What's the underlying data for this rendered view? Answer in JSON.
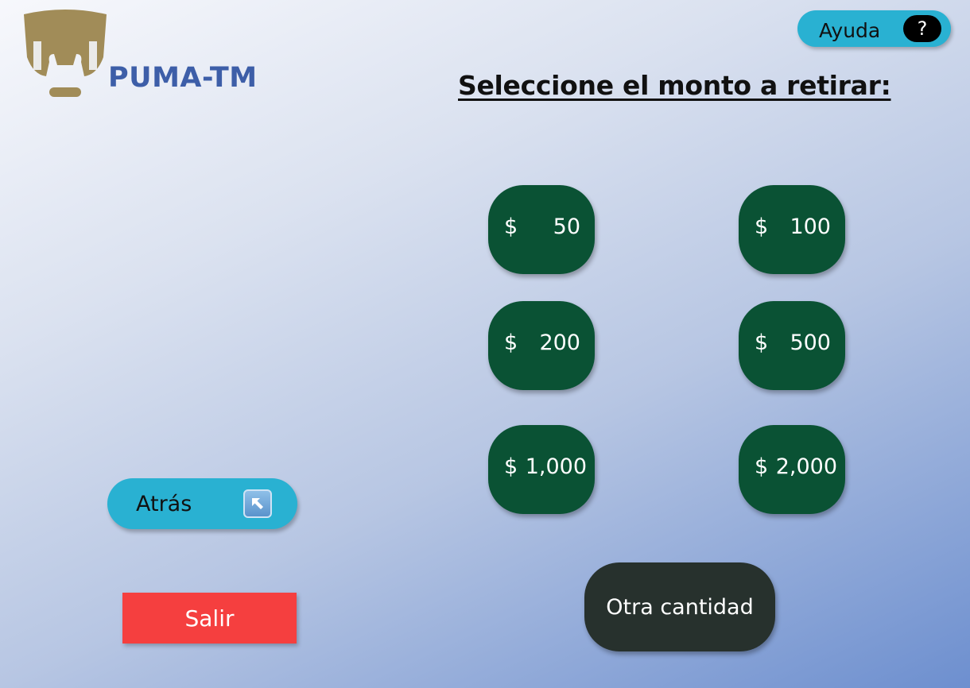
{
  "brand": {
    "name": "PUMA-TM",
    "logo_color": "#a18c58",
    "name_color": "#3d5ea8"
  },
  "help": {
    "label": "Ayuda",
    "icon": "question-icon",
    "icon_glyph": "?"
  },
  "title": "Seleccione el monto a retirar:",
  "amounts": [
    {
      "currency": "$",
      "value": "50"
    },
    {
      "currency": "$",
      "value": "100"
    },
    {
      "currency": "$",
      "value": "200"
    },
    {
      "currency": "$",
      "value": "500"
    },
    {
      "currency": "$",
      "value": "1,000"
    },
    {
      "currency": "$",
      "value": "2,000"
    }
  ],
  "other_amount": {
    "label": "Otra cantidad"
  },
  "back": {
    "label": "Atrás",
    "icon": "arrow-up-left-icon"
  },
  "exit": {
    "label": "Salir"
  },
  "colors": {
    "amount_button": "#0a5234",
    "other_button": "#27312d",
    "accent_button": "#29b1d2",
    "exit_button": "#f53f3f"
  }
}
